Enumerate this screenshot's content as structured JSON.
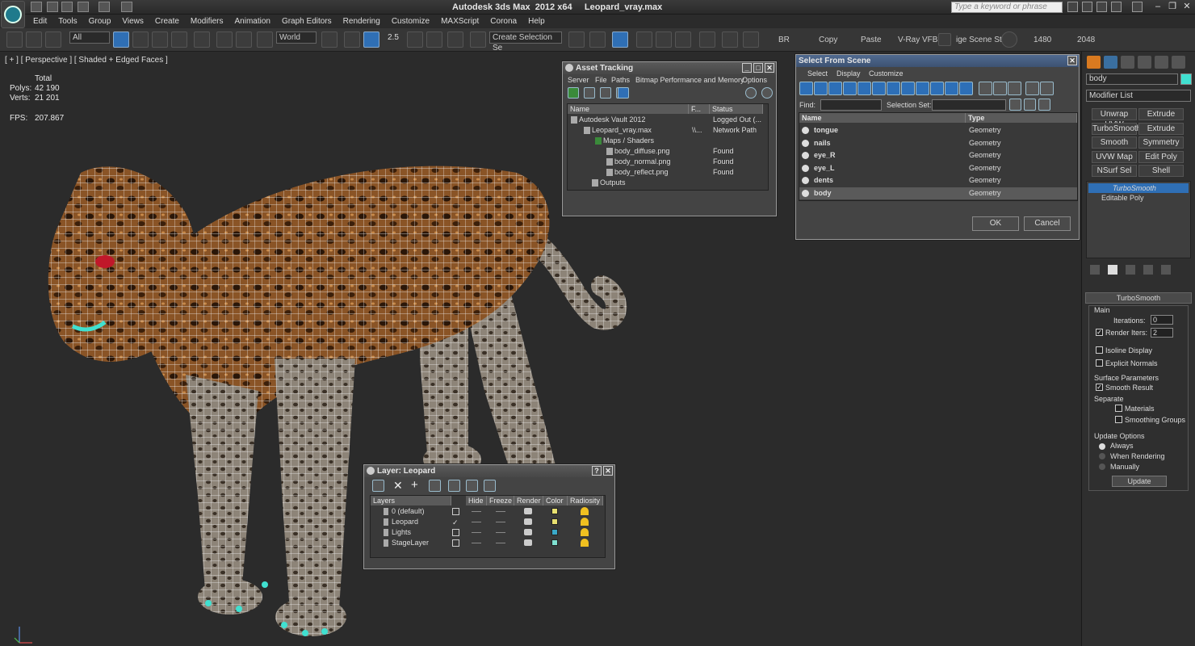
{
  "app": {
    "title": "Autodesk 3ds Max  2012 x64     Leopard_vray.max",
    "search_placeholder": "Type a keyword or phrase"
  },
  "menu": [
    "Edit",
    "Tools",
    "Group",
    "Views",
    "Create",
    "Modifiers",
    "Animation",
    "Graph Editors",
    "Rendering",
    "Customize",
    "MAXScript",
    "Corona",
    "Help"
  ],
  "toolbar": {
    "filter_value": "All",
    "coord_value": "World",
    "angle_snap": "2.5",
    "selection_set_placeholder": "Create Selection Se",
    "buttons_text": [
      "BR",
      "Copy",
      "Paste",
      "V-Ray VFB",
      "ige Scene Stat",
      "1480",
      "2048"
    ]
  },
  "viewport": {
    "label": "[ + ] [ Perspective ] [ Shaded + Edged Faces ]",
    "stats": {
      "total_label": "Total",
      "polys_label": "Polys:",
      "polys_value": "42 190",
      "verts_label": "Verts:",
      "verts_value": "21 201",
      "fps_label": "FPS:",
      "fps_value": "207.867"
    }
  },
  "asset_tracking": {
    "title": "Asset Tracking",
    "menu": [
      "Server",
      "File",
      "Paths",
      "Bitmap Performance and Memory",
      "Options"
    ],
    "columns": [
      "Name",
      "F...",
      "Status"
    ],
    "rows": [
      {
        "name": "Autodesk Vault 2012",
        "f": "",
        "status": "Logged Out (..."
      },
      {
        "name": "Leopard_vray.max",
        "f": "\\\\...",
        "status": "Network Path"
      },
      {
        "name": "Maps / Shaders",
        "f": "",
        "status": ""
      },
      {
        "name": "body_diffuse.png",
        "f": "",
        "status": "Found"
      },
      {
        "name": "body_normal.png",
        "f": "",
        "status": "Found"
      },
      {
        "name": "body_reflect.png",
        "f": "",
        "status": "Found"
      },
      {
        "name": "Outputs",
        "f": "",
        "status": ""
      }
    ]
  },
  "select_from_scene": {
    "title": "Select From Scene",
    "menu": [
      "Select",
      "Display",
      "Customize"
    ],
    "find_label": "Find:",
    "selection_set_label": "Selection Set:",
    "columns": [
      "Name",
      "Type"
    ],
    "rows": [
      {
        "name": "tongue",
        "type": "Geometry"
      },
      {
        "name": "nails",
        "type": "Geometry"
      },
      {
        "name": "eye_R",
        "type": "Geometry"
      },
      {
        "name": "eye_L",
        "type": "Geometry"
      },
      {
        "name": "dents",
        "type": "Geometry"
      },
      {
        "name": "body",
        "type": "Geometry"
      }
    ],
    "ok": "OK",
    "cancel": "Cancel"
  },
  "layer_window": {
    "title": "Layer: Leopard",
    "columns": [
      "Layers",
      "Hide",
      "Freeze",
      "Render",
      "Color",
      "Radiosity"
    ],
    "rows": [
      {
        "name": "0 (default)",
        "active": false,
        "color": "#e8e070"
      },
      {
        "name": "Leopard",
        "active": true,
        "color": "#e8e070"
      },
      {
        "name": "Lights",
        "active": false,
        "color": "#3aa8c8"
      },
      {
        "name": "StageLayer",
        "active": false,
        "color": "#7fe0d0"
      }
    ]
  },
  "command_panel": {
    "object_name": "body",
    "modifier_list": "Modifier List",
    "modifier_buttons": [
      "Unwrap UVW",
      "Extrude",
      "TurboSmooth",
      "Extrude",
      "Smooth",
      "Symmetry",
      "UVW Map",
      "Edit Poly",
      "NSurf Sel",
      "Shell"
    ],
    "stack": [
      "TurboSmooth",
      "Editable Poly"
    ],
    "rollout_title": "TurboSmooth",
    "main_label": "Main",
    "iterations_label": "Iterations:",
    "iterations_value": "0",
    "render_iters_label": "Render Iters:",
    "render_iters_value": "2",
    "isoline_label": "Isoline Display",
    "explicit_normals_label": "Explicit Normals",
    "surface_params_label": "Surface Parameters",
    "smooth_result_label": "Smooth Result",
    "separate_label": "Separate",
    "materials_label": "Materials",
    "smoothing_groups_label": "Smoothing Groups",
    "update_options_label": "Update Options",
    "always_label": "Always",
    "when_rendering_label": "When Rendering",
    "manually_label": "Manually",
    "update_button": "Update"
  },
  "colors": {
    "accent": "#2f6fb5",
    "viewport_bg": "#2b2b2b",
    "panel_bg": "#444444"
  }
}
